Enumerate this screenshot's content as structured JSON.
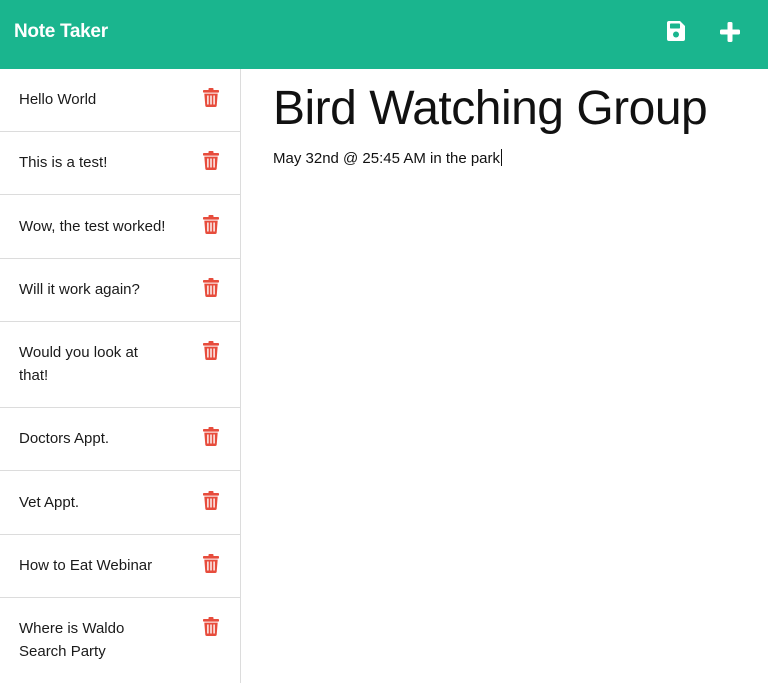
{
  "app": {
    "title": "Note Taker",
    "accent_color": "#1ab58e",
    "delete_color": "#e74c3c"
  },
  "toolbar": {
    "save_icon": "floppy-disk-icon",
    "new_icon": "plus-icon"
  },
  "notes": [
    {
      "title": "Hello World"
    },
    {
      "title": "This is a test!"
    },
    {
      "title": "Wow, the test worked!"
    },
    {
      "title": "Will it work again?"
    },
    {
      "title": "Would you look at that!"
    },
    {
      "title": "Doctors Appt."
    },
    {
      "title": "Vet Appt."
    },
    {
      "title": "How to Eat Webinar"
    },
    {
      "title": "Where is Waldo Search Party"
    }
  ],
  "active_note": {
    "title": "Bird Watching Group",
    "text": "May 32nd @ 25:45 AM in the park"
  }
}
